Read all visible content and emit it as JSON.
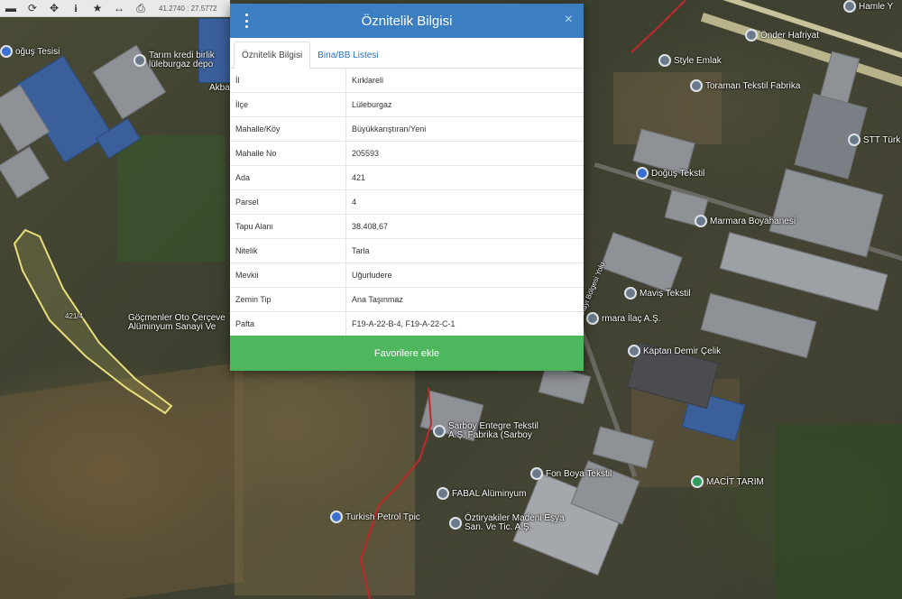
{
  "toolbar": {
    "buttons": [
      {
        "icon": "minus-icon",
        "glyph": "▬"
      },
      {
        "icon": "refresh-icon",
        "glyph": "⟳"
      },
      {
        "icon": "move-icon",
        "glyph": "✥"
      },
      {
        "icon": "info-icon",
        "glyph": "i"
      },
      {
        "icon": "star-icon",
        "glyph": "★"
      },
      {
        "icon": "measure-icon",
        "glyph": "↔"
      },
      {
        "icon": "print-icon",
        "glyph": "⎙"
      }
    ],
    "coordinates": "41.2740 : 27.5772"
  },
  "map": {
    "parcel_label": "421/4",
    "pois": [
      {
        "name": "poi-tarim-kredi",
        "label": "Tarım kredi birlik lüleburgaz depo",
        "pin": "grey"
      },
      {
        "name": "poi-dogus-tesisi",
        "label": "oğuş Tesisi",
        "pin": "blue"
      },
      {
        "name": "poi-akba",
        "label": "Akba",
        "pin": "none"
      },
      {
        "name": "poi-hamle",
        "label": "Hamle Y",
        "pin": "grey"
      },
      {
        "name": "poi-onder-hafriyat",
        "label": "Önder Hafriyat",
        "pin": "grey"
      },
      {
        "name": "poi-style-emlak",
        "label": "Style Emlak",
        "pin": "grey"
      },
      {
        "name": "poi-toraman",
        "label": "Toraman Tekstil Fabrika",
        "pin": "grey"
      },
      {
        "name": "poi-stt",
        "label": "STT Türk",
        "pin": "grey"
      },
      {
        "name": "poi-dogus-tekstil",
        "label": "Doğuş Tekstil",
        "pin": "blue"
      },
      {
        "name": "poi-marmara-boya",
        "label": "Marmara Boyahanesi",
        "pin": "grey"
      },
      {
        "name": "poi-mavis",
        "label": "Maviş Tekstil",
        "pin": "grey"
      },
      {
        "name": "poi-marmara-ilac",
        "label": "rmara İlaç A.Ş.",
        "pin": "grey"
      },
      {
        "name": "poi-kaptan",
        "label": "Kaptan Demir Çelik",
        "pin": "grey"
      },
      {
        "name": "poi-gocmenler",
        "label": "Göçmenler Oto Çerçeve Alüminyum Sanayi Ve",
        "pin": "none"
      },
      {
        "name": "poi-sarboy",
        "label": "Sarboy Entegre Tekstil A.Ş. Fabrika (Sarboy",
        "pin": "grey"
      },
      {
        "name": "poi-fon-boya",
        "label": "Fon Boya Tekstil",
        "pin": "grey"
      },
      {
        "name": "poi-macit",
        "label": "MACİT TARIM",
        "pin": "green"
      },
      {
        "name": "poi-fabal",
        "label": "FABAL Alüminyum",
        "pin": "grey"
      },
      {
        "name": "poi-turkish-petrol",
        "label": "Turkish Petrol Tpic",
        "pin": "blue"
      },
      {
        "name": "poi-oztiryakiler",
        "label": "Öztiryakiler Madeni Eşya San. Ve Tic. A.Ş.",
        "pin": "grey"
      },
      {
        "name": "poi-road",
        "label": "Mimar Sinan Sanayi Bölgesi Yolu",
        "pin": "none"
      }
    ]
  },
  "modal": {
    "title": "Öznitelik Bilgisi",
    "close_glyph": "×",
    "tabs": [
      {
        "label": "Öznitelik Bilgisi",
        "active": true
      },
      {
        "label": "Bina/BB Listesi",
        "active": false
      }
    ],
    "rows": [
      {
        "key": "İl",
        "value": "Kırklareli"
      },
      {
        "key": "İlçe",
        "value": "Lüleburgaz"
      },
      {
        "key": "Mahalle/Köy",
        "value": "Büyükkarıştıran/Yeni"
      },
      {
        "key": "Mahalle No",
        "value": "205593"
      },
      {
        "key": "Ada",
        "value": "421"
      },
      {
        "key": "Parsel",
        "value": "4"
      },
      {
        "key": "Tapu Alanı",
        "value": "38.408,67"
      },
      {
        "key": "Nitelik",
        "value": "Tarla"
      },
      {
        "key": "Mevkii",
        "value": "Uğurludere"
      },
      {
        "key": "Zemin Tip",
        "value": "Ana Taşınmaz"
      },
      {
        "key": "Pafta",
        "value": "F19-A-22-B-4, F19-A-22-C-1"
      }
    ],
    "favorite_button": "Favorilere ekle"
  },
  "colors": {
    "header": "#3b7ec1",
    "favorite_button": "#4cb75c",
    "parcel_outline": "#e8e07a",
    "boundary_line": "#c0282a"
  }
}
